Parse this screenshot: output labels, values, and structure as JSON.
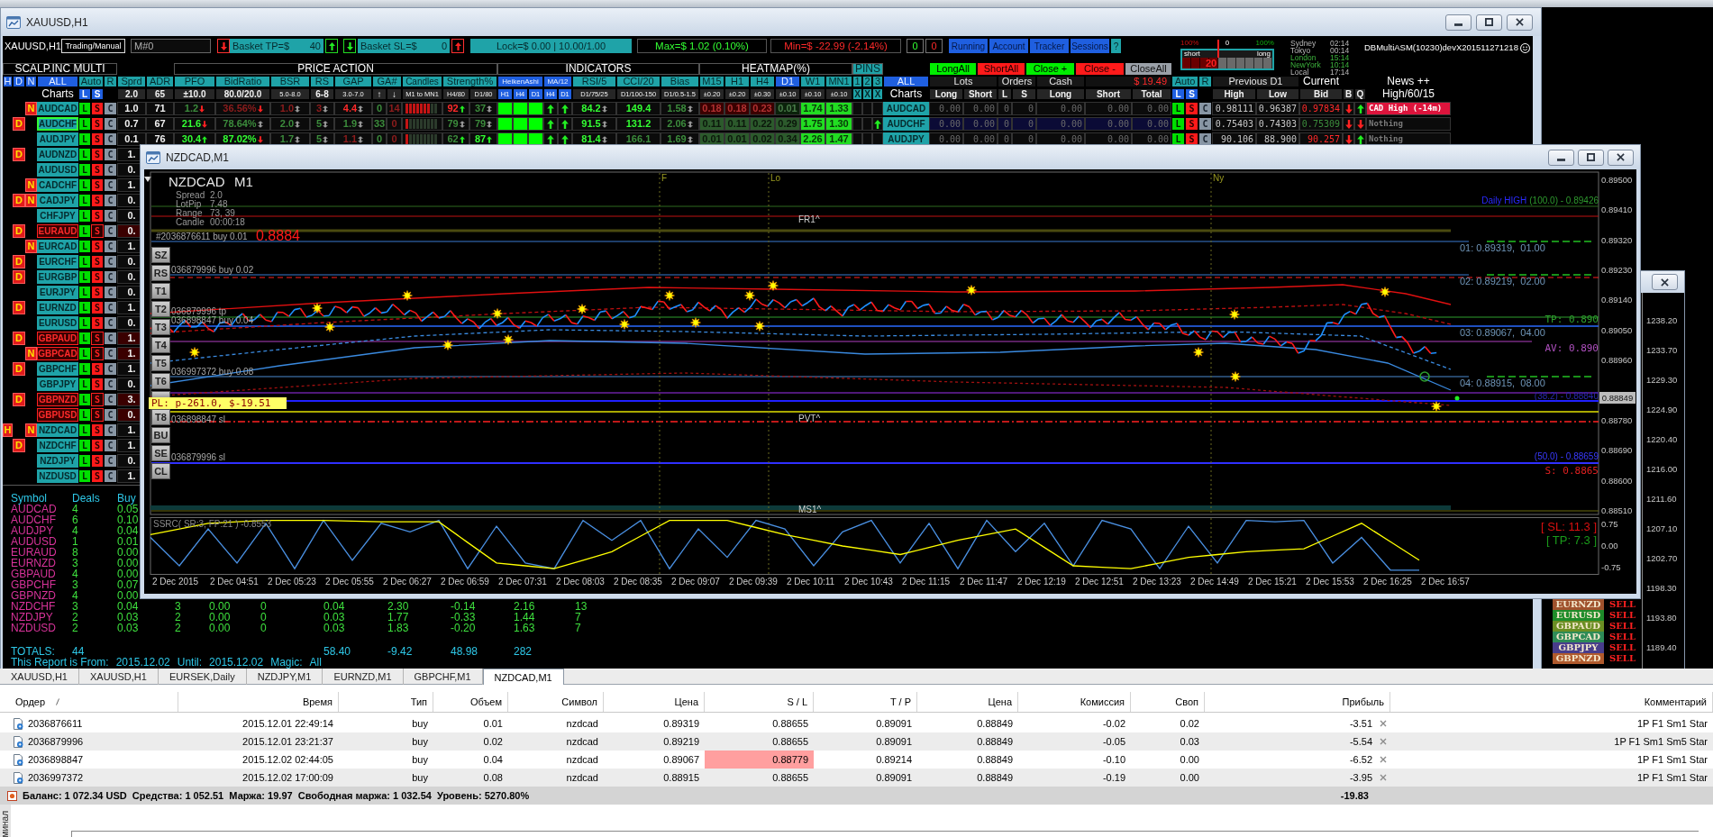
{
  "main_window": {
    "title": "XAUUSD,H1"
  },
  "dashboard": {
    "toolbar": {
      "chart_label": "XAUUSD,H1",
      "mode": "Trading/Manual",
      "magic": {
        "value": "M#0"
      },
      "basket_tp": {
        "label": "Basket TP=$",
        "value": "40"
      },
      "basket_sl": {
        "label": "Basket SL=$",
        "value": "0"
      },
      "lock": "Lock=$ 0.00 | 10.00/1.00",
      "max": "Max=$ 1.02 (0.10%)",
      "min": "Min=$ -22.99 (-2.14%)",
      "counters": [
        {
          "value": "0",
          "kind": "buy"
        },
        {
          "value": "0",
          "kind": "sell"
        }
      ],
      "panel_buttons": [
        {
          "label": "Running",
          "kind": "panel"
        },
        {
          "label": "Account",
          "kind": "panel"
        },
        {
          "label": "Tracker",
          "kind": "panel"
        },
        {
          "label": "Sessions",
          "kind": "panel"
        },
        {
          "label": "?",
          "kind": "help"
        }
      ]
    },
    "trade_buttons": [
      {
        "label": "LongAll",
        "kind": "long"
      },
      {
        "label": "ShortAll",
        "kind": "short"
      },
      {
        "label": "Close +",
        "kind": "long"
      },
      {
        "label": "Close -",
        "kind": "short"
      },
      {
        "label": "CloseAll",
        "kind": "neutral"
      }
    ],
    "gauge": {
      "short_max": "100%",
      "center": "0",
      "long_max": "100%",
      "short_label": "short",
      "long_label": "long",
      "value": "20",
      "level": 0.4
    },
    "sessions": [
      {
        "city": "Sydney",
        "time": "02:14",
        "open": false
      },
      {
        "city": "Tokyo",
        "time": "00:14",
        "open": false
      },
      {
        "city": "London",
        "time": "15:14",
        "open": true
      },
      {
        "city": "NewYork",
        "time": "10:14",
        "open": true
      },
      {
        "city": "Local",
        "time": "17:14",
        "open": false
      }
    ],
    "version": "DBMultiASM(10230)devX201511271218",
    "sections": [
      "SCALP.INC MULTI",
      "PRICE ACTION",
      "INDICATORS",
      "HEATMAP(%)",
      "PINS"
    ],
    "header": [
      "H",
      "D",
      "N",
      "ALL",
      "Auto",
      "R",
      "Sprd",
      "ADR",
      "PFO",
      "BidRatio",
      "BSR",
      "RS",
      "GAP",
      "GA#",
      "Candles",
      "Strength%",
      "HeikenAshi",
      "MA/12",
      "RSI/5",
      "CCI/20",
      "Bias",
      "M15",
      "H1",
      "H4",
      "D1",
      "W1",
      "MN1",
      "1",
      "2",
      "3",
      "ALL",
      "Lots",
      "Orders",
      "Cash",
      "$ 19.49",
      "Auto",
      "R",
      "Previous D1",
      "Current",
      "News ++"
    ],
    "subheader": [
      "Charts",
      "L",
      "S",
      "2.0",
      "65",
      "±10.0",
      "80.0/20.0",
      "5.0-8.0",
      "6-8",
      "3.0-7.0",
      "↑",
      "↓",
      "M1 to MN1",
      "H4/80",
      "D1/80",
      "H1",
      "H4",
      "D1",
      "H4",
      "D1",
      "D1/75/25",
      "D1/100-150",
      "D1/0.5-1.5",
      "±0.20",
      "±0.20",
      "±0.30",
      "±0.10",
      "±0.10",
      "±0.10",
      "X",
      "X",
      "X",
      "Charts",
      "Long",
      "Short",
      "L",
      "S",
      "Long",
      "Short",
      "Total",
      "L",
      "S",
      "High",
      "Low",
      "Bid",
      "B",
      "Q",
      "High/60/15"
    ],
    "rows": [
      {
        "flags": [
          {
            "kind": "n",
            "label": "N"
          }
        ],
        "symbol": "AUDCAD",
        "alert": false,
        "active": false,
        "buttons": [
          "L",
          "S",
          "C"
        ],
        "cells": [
          {
            "kind": "value",
            "text": "1.0"
          },
          {
            "kind": "value",
            "text": "71"
          },
          {
            "kind": "value",
            "text": "1.2",
            "color": "#3c8c3c",
            "down": true
          },
          {
            "kind": "value",
            "text": "36.56%",
            "color": "#8f1d1d",
            "down": true
          },
          {
            "kind": "value",
            "text": "1.0",
            "color": "#8f1d1d",
            "up": true,
            "down": true
          },
          {
            "kind": "value",
            "text": "3",
            "color": "#8f1d1d",
            "up": true,
            "down": true
          },
          {
            "kind": "value",
            "text": "4.4",
            "color": "#ff2a2a",
            "up": true,
            "down": true
          },
          {
            "kind": "value",
            "text": "0",
            "color": "#3c8c3c"
          },
          {
            "kind": "value",
            "text": "14",
            "color": "#8f1d1d"
          },
          {
            "kind": "bars",
            "bars": [
              {
                "color": "#c41414"
              },
              {
                "color": "#c41414"
              },
              {
                "color": "#c41414"
              },
              {
                "color": "#c41414"
              },
              {
                "color": "#c41414"
              },
              {
                "color": "#c41414"
              },
              {
                "color": "#c41414"
              },
              {
                "color": "#2b3a2b"
              },
              {
                "color": "#2b3a2b"
              }
            ]
          },
          {
            "kind": "value",
            "text": "92",
            "color": "#ff2a2a",
            "up": true
          },
          {
            "kind": "value",
            "text": "37",
            "color": "#3c8c3c",
            "up": true,
            "down": true
          },
          {
            "kind": "signal",
            "color": "#00ff00"
          },
          {
            "kind": "signal",
            "color": "#00ff00"
          },
          {
            "kind": "signal",
            "color": "#00ff00"
          },
          {
            "kind": "arrow",
            "up": true
          },
          {
            "kind": "arrow",
            "up": true
          },
          {
            "kind": "value",
            "text": "84.2",
            "color": "#33ff33",
            "up": true,
            "down": true
          },
          {
            "kind": "value",
            "text": "149.4",
            "color": "#33ff33"
          },
          {
            "kind": "value",
            "text": "1.58",
            "color": "#3c8c3c",
            "up": true,
            "down": true
          },
          {
            "kind": "heat",
            "text": "0.18",
            "color": "#3a0000"
          },
          {
            "kind": "heat",
            "text": "0.18",
            "color": "#3a0000"
          },
          {
            "kind": "heat",
            "text": "0.23",
            "color": "#3a0000"
          },
          {
            "kind": "heat",
            "text": "0.01",
            "color": "#0b220b"
          },
          {
            "kind": "heat",
            "text": "1.74",
            "color": "#22dd22"
          },
          {
            "kind": "heat",
            "text": "1.33",
            "color": "#22dd22"
          },
          {
            "kind": "blank"
          },
          {
            "kind": "blank"
          },
          {
            "kind": "blank"
          },
          {
            "kind": "symbol",
            "text": "AUDCAD"
          },
          {
            "kind": "value",
            "text": "0.00",
            "dim": true
          },
          {
            "kind": "value",
            "text": "0.00",
            "dim": true
          },
          {
            "kind": "value",
            "text": "0",
            "dim": true
          },
          {
            "kind": "value",
            "text": "0",
            "dim": true
          },
          {
            "kind": "value",
            "text": "0.00",
            "dim": true
          },
          {
            "kind": "value",
            "text": "0.00",
            "dim": true
          },
          {
            "kind": "value",
            "text": "0.00",
            "dim": true
          },
          {
            "kind": "long",
            "text": "L"
          },
          {
            "kind": "short",
            "text": "S"
          },
          {
            "kind": "close",
            "text": "C"
          },
          {
            "kind": "value",
            "text": "0.98111"
          },
          {
            "kind": "value",
            "text": "0.96387"
          },
          {
            "kind": "value",
            "text": "0.97834",
            "color": "#ff2a2a"
          },
          {
            "kind": "arrow",
            "down": true
          },
          {
            "kind": "arrow",
            "up": true
          },
          {
            "kind": "news",
            "text": "CAD High (-14m)",
            "color": "#dc143c",
            "dim": false
          }
        ]
      },
      {
        "flags": [
          {
            "kind": "d",
            "label": "D"
          }
        ],
        "symbol": "AUDCHF",
        "alert": false,
        "active": true,
        "buttons": [
          "L",
          "S",
          "C"
        ],
        "cells": [
          {
            "kind": "value",
            "text": "0.7"
          },
          {
            "kind": "value",
            "text": "67"
          },
          {
            "kind": "value",
            "text": "21.6",
            "color": "#33ff33",
            "down": true
          },
          {
            "kind": "value",
            "text": "78.64%",
            "color": "#3c8c3c",
            "up": true,
            "down": true
          },
          {
            "kind": "value",
            "text": "2.0",
            "color": "#3c8c3c",
            "up": true,
            "down": true
          },
          {
            "kind": "value",
            "text": "5",
            "color": "#3c8c3c",
            "up": true,
            "down": true
          },
          {
            "kind": "value",
            "text": "1.9",
            "color": "#3c8c3c",
            "up": true,
            "down": true
          },
          {
            "kind": "value",
            "text": "33",
            "color": "#3c8c3c"
          },
          {
            "kind": "value",
            "text": "0",
            "color": "#8f1d1d"
          },
          {
            "kind": "bars",
            "bars": [
              {
                "color": "#c41414"
              },
              {
                "color": "#2b3a2b"
              },
              {
                "color": "#2b3a2b"
              },
              {
                "color": "#2b3a2b"
              },
              {
                "color": "#2b3a2b"
              },
              {
                "color": "#2b3a2b"
              },
              {
                "color": "#2b3a2b"
              },
              {
                "color": "#2b3a2b"
              },
              {
                "color": "#2b3a2b"
              }
            ]
          },
          {
            "kind": "value",
            "text": "79",
            "color": "#3c8c3c",
            "up": true,
            "down": true
          },
          {
            "kind": "value",
            "text": "79",
            "color": "#3c8c3c",
            "up": true,
            "down": true
          },
          {
            "kind": "signal",
            "color": "#00ff00"
          },
          {
            "kind": "signal",
            "color": "#00ff00"
          },
          {
            "kind": "signal",
            "color": "#00ff00"
          },
          {
            "kind": "arrow",
            "up": true
          },
          {
            "kind": "arrow",
            "up": true
          },
          {
            "kind": "value",
            "text": "91.5",
            "color": "#33ff33",
            "up": true,
            "down": true
          },
          {
            "kind": "value",
            "text": "131.2",
            "color": "#33ff33"
          },
          {
            "kind": "value",
            "text": "2.06",
            "color": "#3c8c3c",
            "up": true,
            "down": true
          },
          {
            "kind": "heat",
            "text": "0.11",
            "color": "#2c5a2c"
          },
          {
            "kind": "heat",
            "text": "0.11",
            "color": "#2c5a2c"
          },
          {
            "kind": "heat",
            "text": "0.22",
            "color": "#2c5a2c"
          },
          {
            "kind": "heat",
            "text": "0.29",
            "color": "#2c5a2c"
          },
          {
            "kind": "heat",
            "text": "1.75",
            "color": "#22dd22"
          },
          {
            "kind": "heat",
            "text": "1.30",
            "color": "#22dd22"
          },
          {
            "kind": "blank"
          },
          {
            "kind": "blank"
          },
          {
            "kind": "arrow",
            "up": true
          },
          {
            "kind": "symbol",
            "text": "AUDCHF"
          },
          {
            "kind": "value",
            "text": "0.00",
            "dim": true
          },
          {
            "kind": "value",
            "text": "0.00",
            "dim": true
          },
          {
            "kind": "value",
            "text": "0",
            "dim": true
          },
          {
            "kind": "value",
            "text": "0",
            "dim": true
          },
          {
            "kind": "value",
            "text": "0.00",
            "dim": true
          },
          {
            "kind": "value",
            "text": "0.00",
            "dim": true
          },
          {
            "kind": "value",
            "text": "0.00",
            "dim": true
          },
          {
            "kind": "long",
            "text": "L"
          },
          {
            "kind": "short",
            "text": "S"
          },
          {
            "kind": "close",
            "text": "C"
          },
          {
            "kind": "value",
            "text": "0.75403"
          },
          {
            "kind": "value",
            "text": "0.74303"
          },
          {
            "kind": "value",
            "text": "0.75309",
            "color": "#3c8c3c"
          },
          {
            "kind": "arrow",
            "down": true
          },
          {
            "kind": "arrow",
            "down": true
          },
          {
            "kind": "news",
            "text": "Nothing",
            "dim": true
          }
        ]
      },
      {
        "flags": [],
        "symbol": "AUDJPY",
        "alert": false,
        "active": false,
        "buttons": [
          "L",
          "S",
          "C"
        ],
        "cells": [
          {
            "kind": "value",
            "text": "0.1"
          },
          {
            "kind": "value",
            "text": "76"
          },
          {
            "kind": "value",
            "text": "30.4",
            "color": "#33ff33",
            "up": true
          },
          {
            "kind": "value",
            "text": "87.02%",
            "color": "#33ff33",
            "down": true
          },
          {
            "kind": "value",
            "text": "1.7",
            "color": "#3c8c3c",
            "up": true,
            "down": true
          },
          {
            "kind": "value",
            "text": "5",
            "color": "#3c8c3c",
            "up": true,
            "down": true
          },
          {
            "kind": "value",
            "text": "1.1",
            "color": "#8f1d1d",
            "up": true,
            "down": true
          },
          {
            "kind": "value",
            "text": "0",
            "color": "#3c8c3c"
          },
          {
            "kind": "value",
            "text": "0",
            "color": "#8f1d1d"
          },
          {
            "kind": "bars",
            "bars": [
              {
                "color": "#c41414"
              },
              {
                "color": "#2b3a2b"
              },
              {
                "color": "#2b3a2b"
              },
              {
                "color": "#2b3a2b"
              },
              {
                "color": "#2b3a2b"
              },
              {
                "color": "#2b3a2b"
              },
              {
                "color": "#2b3a2b"
              },
              {
                "color": "#2b3a2b"
              },
              {
                "color": "#2b3a2b"
              }
            ]
          },
          {
            "kind": "value",
            "text": "62",
            "color": "#3c8c3c",
            "up": true
          },
          {
            "kind": "value",
            "text": "87",
            "color": "#33ff33",
            "up": true
          },
          {
            "kind": "signal",
            "color": "#00ff00"
          },
          {
            "kind": "signal",
            "color": "#00ff00"
          },
          {
            "kind": "signal",
            "color": "#00ff00"
          },
          {
            "kind": "arrow",
            "up": true
          },
          {
            "kind": "arrow",
            "up": true
          },
          {
            "kind": "value",
            "text": "81.4",
            "color": "#33ff33",
            "up": true,
            "down": true
          },
          {
            "kind": "value",
            "text": "166.1",
            "color": "#3c8c3c"
          },
          {
            "kind": "value",
            "text": "1.69",
            "color": "#3c8c3c",
            "up": true,
            "down": true
          },
          {
            "kind": "heat",
            "text": "0.01",
            "color": "#2c5a2c"
          },
          {
            "kind": "heat",
            "text": "0.01",
            "color": "#2c5a2c"
          },
          {
            "kind": "heat",
            "text": "0.02",
            "color": "#2c5a2c"
          },
          {
            "kind": "heat",
            "text": "0.34",
            "color": "#2c5a2c"
          },
          {
            "kind": "heat",
            "text": "2.26",
            "color": "#22dd22"
          },
          {
            "kind": "heat",
            "text": "1.47",
            "color": "#22dd22"
          },
          {
            "kind": "blank"
          },
          {
            "kind": "blank"
          },
          {
            "kind": "blank"
          },
          {
            "kind": "symbol",
            "text": "AUDJPY"
          },
          {
            "kind": "value",
            "text": "0.00",
            "dim": true
          },
          {
            "kind": "value",
            "text": "0.00",
            "dim": true
          },
          {
            "kind": "value",
            "text": "0",
            "dim": true
          },
          {
            "kind": "value",
            "text": "0",
            "dim": true
          },
          {
            "kind": "value",
            "text": "0.00",
            "dim": true
          },
          {
            "kind": "value",
            "text": "0.00",
            "dim": true
          },
          {
            "kind": "value",
            "text": "0.00",
            "dim": true
          },
          {
            "kind": "long",
            "text": "L"
          },
          {
            "kind": "short",
            "text": "S"
          },
          {
            "kind": "close",
            "text": "C"
          },
          {
            "kind": "value",
            "text": "90.106"
          },
          {
            "kind": "value",
            "text": "88.900"
          },
          {
            "kind": "value",
            "text": "90.257",
            "color": "#ff2a2a"
          },
          {
            "kind": "arrow",
            "down": true
          },
          {
            "kind": "arrow",
            "up": true
          },
          {
            "kind": "news",
            "text": "Nothing",
            "dim": true
          }
        ]
      },
      {
        "flags": [
          {
            "kind": "d",
            "label": "D"
          }
        ],
        "symbol": "AUDNZD",
        "alert": false,
        "active": false,
        "buttons": [
          "L",
          "S",
          "C"
        ],
        "cells": [
          {
            "kind": "value",
            "text": "1."
          }
        ]
      },
      {
        "flags": [],
        "symbol": "AUDUSD",
        "alert": false,
        "active": false,
        "buttons": [
          "L",
          "S",
          "C"
        ],
        "cells": [
          {
            "kind": "value",
            "text": "0."
          }
        ]
      },
      {
        "flags": [
          {
            "kind": "n",
            "label": "N"
          }
        ],
        "symbol": "CADCHF",
        "alert": false,
        "active": false,
        "buttons": [
          "L",
          "S",
          "C"
        ],
        "cells": [
          {
            "kind": "value",
            "text": "1."
          }
        ]
      },
      {
        "flags": [
          {
            "kind": "d",
            "label": "D"
          },
          {
            "kind": "n",
            "label": "N"
          }
        ],
        "symbol": "CADJPY",
        "alert": false,
        "active": false,
        "buttons": [
          "L",
          "S",
          "C"
        ],
        "cells": [
          {
            "kind": "value",
            "text": "0."
          }
        ]
      },
      {
        "flags": [],
        "symbol": "CHFJPY",
        "alert": false,
        "active": false,
        "buttons": [
          "L",
          "S",
          "C"
        ],
        "cells": [
          {
            "kind": "value",
            "text": "0."
          }
        ]
      },
      {
        "flags": [
          {
            "kind": "d",
            "label": "D"
          }
        ],
        "symbol": "EURAUD",
        "alert": true,
        "active": false,
        "buttons": [
          "L",
          "S",
          "C"
        ],
        "cells": [
          {
            "kind": "value",
            "text": "0."
          }
        ]
      },
      {
        "flags": [
          {
            "kind": "n",
            "label": "N"
          }
        ],
        "symbol": "EURCAD",
        "alert": false,
        "active": false,
        "buttons": [
          "L",
          "S",
          "C"
        ],
        "cells": [
          {
            "kind": "value",
            "text": "1."
          }
        ]
      },
      {
        "flags": [
          {
            "kind": "d",
            "label": "D"
          }
        ],
        "symbol": "EURCHF",
        "alert": false,
        "active": false,
        "buttons": [
          "L",
          "S",
          "C"
        ],
        "cells": [
          {
            "kind": "value",
            "text": "0."
          }
        ]
      },
      {
        "flags": [
          {
            "kind": "d",
            "label": "D"
          }
        ],
        "symbol": "EURGBP",
        "alert": false,
        "active": false,
        "buttons": [
          "L",
          "S",
          "C"
        ],
        "cells": [
          {
            "kind": "value",
            "text": "0."
          }
        ]
      },
      {
        "flags": [],
        "symbol": "EURJPY",
        "alert": false,
        "active": false,
        "buttons": [
          "L",
          "S",
          "C"
        ],
        "cells": [
          {
            "kind": "value",
            "text": "0."
          }
        ]
      },
      {
        "flags": [
          {
            "kind": "d",
            "label": "D"
          }
        ],
        "symbol": "EURNZD",
        "alert": false,
        "active": false,
        "buttons": [
          "L",
          "S",
          "C"
        ],
        "cells": [
          {
            "kind": "value",
            "text": "1."
          }
        ]
      },
      {
        "flags": [],
        "symbol": "EURUSD",
        "alert": false,
        "active": false,
        "buttons": [
          "L",
          "S",
          "C"
        ],
        "cells": [
          {
            "kind": "value",
            "text": "0."
          }
        ]
      },
      {
        "flags": [
          {
            "kind": "d",
            "label": "D"
          }
        ],
        "symbol": "GBPAUD",
        "alert": true,
        "active": false,
        "buttons": [
          "L",
          "S",
          "C"
        ],
        "cells": [
          {
            "kind": "value",
            "text": "1."
          }
        ]
      },
      {
        "flags": [
          {
            "kind": "n",
            "label": "N"
          }
        ],
        "symbol": "GBPCAD",
        "alert": true,
        "active": false,
        "buttons": [
          "L",
          "S",
          "C"
        ],
        "cells": [
          {
            "kind": "value",
            "text": "1."
          }
        ]
      },
      {
        "flags": [
          {
            "kind": "d",
            "label": "D"
          }
        ],
        "symbol": "GBPCHF",
        "alert": false,
        "active": false,
        "buttons": [
          "L",
          "S",
          "C"
        ],
        "cells": [
          {
            "kind": "value",
            "text": "1."
          }
        ]
      },
      {
        "flags": [],
        "symbol": "GBPJPY",
        "alert": false,
        "active": false,
        "buttons": [
          "L",
          "S",
          "C"
        ],
        "cells": [
          {
            "kind": "value",
            "text": "0."
          }
        ]
      },
      {
        "flags": [
          {
            "kind": "d",
            "label": "D"
          }
        ],
        "symbol": "GBPNZD",
        "alert": true,
        "active": false,
        "buttons": [
          "L",
          "S",
          "C"
        ],
        "cells": [
          {
            "kind": "value",
            "text": "3."
          }
        ]
      },
      {
        "flags": [],
        "symbol": "GBPUSD",
        "alert": true,
        "active": false,
        "buttons": [
          "L",
          "S",
          "C"
        ],
        "cells": [
          {
            "kind": "value",
            "text": "0."
          }
        ]
      },
      {
        "flags": [
          {
            "kind": "h",
            "label": "H"
          },
          {
            "kind": "n",
            "label": "N"
          }
        ],
        "symbol": "NZDCAD",
        "alert": false,
        "active": false,
        "buttons": [
          "L",
          "S",
          "C"
        ],
        "cells": [
          {
            "kind": "value",
            "text": "1."
          }
        ]
      },
      {
        "flags": [
          {
            "kind": "d",
            "label": "D"
          }
        ],
        "symbol": "NZDCHF",
        "alert": false,
        "active": false,
        "buttons": [
          "L",
          "S",
          "C"
        ],
        "cells": [
          {
            "kind": "value",
            "text": "1."
          }
        ]
      },
      {
        "flags": [],
        "symbol": "NZDJPY",
        "alert": false,
        "active": false,
        "buttons": [
          "L",
          "S",
          "C"
        ],
        "cells": [
          {
            "kind": "value",
            "text": "0."
          }
        ]
      },
      {
        "flags": [],
        "symbol": "NZDUSD",
        "alert": false,
        "active": false,
        "buttons": [
          "L",
          "S",
          "C"
        ],
        "cells": [
          {
            "kind": "value",
            "text": "1."
          }
        ]
      }
    ]
  },
  "report": {
    "columns": [
      "Symbol",
      "Deals",
      "Buy"
    ],
    "rows": [
      {
        "symbol": "AUDCAD",
        "values": [
          "4",
          "0.05"
        ]
      },
      {
        "symbol": "AUDCHF",
        "values": [
          "6",
          "0.10"
        ]
      },
      {
        "symbol": "AUDJPY",
        "values": [
          "4",
          "0.04"
        ]
      },
      {
        "symbol": "AUDUSD",
        "values": [
          "1",
          "0.01"
        ]
      },
      {
        "symbol": "EURAUD",
        "values": [
          "8",
          "0.00"
        ]
      },
      {
        "symbol": "EURNZD",
        "values": [
          "3",
          "0.00"
        ]
      },
      {
        "symbol": "GBPAUD",
        "values": [
          "4",
          "0.00"
        ]
      },
      {
        "symbol": "GBPCHF",
        "values": [
          "3",
          "0.07"
        ]
      },
      {
        "symbol": "GBPNZD",
        "values": [
          "4",
          "0.00"
        ]
      },
      {
        "symbol": "NZDCHF",
        "values": [
          "3",
          "0.04",
          "3",
          "0.00",
          "0",
          "0.04",
          "2.30",
          "-0.14",
          "2.16",
          "13"
        ]
      },
      {
        "symbol": "NZDJPY",
        "values": [
          "2",
          "0.03",
          "2",
          "0.00",
          "0",
          "0.03",
          "1.77",
          "-0.33",
          "1.44",
          "7"
        ]
      },
      {
        "symbol": "NZDUSD",
        "values": [
          "2",
          "0.03",
          "2",
          "0.00",
          "0",
          "0.03",
          "1.83",
          "-0.20",
          "1.63",
          "7"
        ]
      }
    ],
    "totals": {
      "label": "TOTALS:",
      "values": [
        "44",
        "58.40",
        "-9.42",
        "48.98",
        "282"
      ]
    },
    "period": [
      "This Report is From:",
      "2015.12.02",
      "Until:",
      "2015.12.02",
      "Magic:",
      "All"
    ]
  },
  "chart_window": {
    "title": "NZDCAD,M1",
    "symbol": "NZDCAD",
    "timeframe": "M1",
    "info": [
      {
        "label": "Spread",
        "value": "2.0"
      },
      {
        "label": "LotPip",
        "value": "7.48"
      },
      {
        "label": "Range",
        "value": "73, 39"
      },
      {
        "label": "Candle",
        "value": "00:00:18"
      }
    ],
    "order_label": "#2036876611 buy 0.01",
    "bid": "0.8884",
    "side_buttons": [
      "SZ",
      "RS",
      "T1",
      "T2",
      "T3",
      "T4",
      "T5",
      "T6",
      "T8",
      "BU",
      "SE",
      "CL"
    ],
    "trade_labels": [
      "036879996 buy 0.02",
      "036879996 tp",
      "036898847 buy 0.04",
      "036997372 buy 0.08",
      "036898847 sl",
      "036879996 sl"
    ],
    "pl_label": "PL: p-261.0, $-19.51",
    "session_marks": [
      "F",
      "Lo",
      "Ny"
    ],
    "pivots": [
      "FR1^",
      "PVT^",
      "MS1^"
    ],
    "daily_high": {
      "label": "Daily HIGH",
      "value": "(100.0) - 0.89426"
    },
    "order_levels": [
      "01: 0.89319,  01.00",
      "02: 0.89219,  02.00",
      "03: 0.89067,  04.00",
      "04: 0.88915,  08.00"
    ],
    "tp_label": "TP: 0.890",
    "average_label": "AV: 0.890",
    "fib_labels": [
      "(38.2) - 0.88840",
      "(50.0) - 0.88659"
    ],
    "support_label": "S: 0.8865",
    "current_price": "0.88849",
    "price_ticks": [
      "0.89500",
      "0.89410",
      "0.89320",
      "0.89230",
      "0.89140",
      "0.89050",
      "0.88960",
      "0.88780",
      "0.88690",
      "0.88600",
      "0.88510"
    ],
    "time_labels": [
      "2 Dec 2015",
      "2 Dec 04:51",
      "2 Dec 05:23",
      "2 Dec 05:55",
      "2 Dec 06:27",
      "2 Dec 06:59",
      "2 Dec 07:31",
      "2 Dec 08:03",
      "2 Dec 08:35",
      "2 Dec 09:07",
      "2 Dec 09:39",
      "2 Dec 10:11",
      "2 Dec 10:43",
      "2 Dec 11:15",
      "2 Dec 11:47",
      "2 Dec 12:19",
      "2 Dec 12:51",
      "2 Dec 13:23",
      "2 Dec 14:49",
      "2 Dec 15:21",
      "2 Dec 15:53",
      "2 Dec 16:25",
      "2 Dec 16:57"
    ],
    "oscillator": {
      "title": "SSRC( SR:3, FP:21 ) -0.8553",
      "stop_loss": "[ SL: 11.3 ]",
      "take_profit": "[ TP: 7.3 ]",
      "ticks": [
        "0.75",
        "0.00",
        "-0.75"
      ]
    }
  },
  "side_window": {
    "price_axis": [
      "1238.20",
      "1233.70",
      "1229.30",
      "1224.90",
      "1220.40",
      "1216.00",
      "1211.60",
      "1207.10",
      "1202.70",
      "1198.30",
      "1193.80",
      "1189.40"
    ],
    "signals": [
      {
        "symbol": "EURNZD",
        "action": "SELL",
        "color": "#a0522d"
      },
      {
        "symbol": "EURUSD",
        "action": "SELL",
        "color": "#1e8c2a"
      },
      {
        "symbol": "GBPAUD",
        "action": "SELL",
        "color": "#6b8e23"
      },
      {
        "symbol": "GBPCAD",
        "action": "SELL",
        "color": "#2e8b57"
      },
      {
        "symbol": "GBPJPY",
        "action": "SELL",
        "color": "#483d8b"
      },
      {
        "symbol": "GBPNZD",
        "action": "SELL",
        "color": "#b05a2d"
      }
    ]
  },
  "terminal": {
    "tabs": [
      {
        "label": "XAUUSD,H1",
        "selected": false
      },
      {
        "label": "XAUUSD,H1",
        "selected": false
      },
      {
        "label": "EURSEK,Daily",
        "selected": false
      },
      {
        "label": "NZDJPY,M1",
        "selected": false
      },
      {
        "label": "EURNZD,M1",
        "selected": false
      },
      {
        "label": "GBPCHF,M1",
        "selected": false
      },
      {
        "label": "NZDCAD,M1",
        "selected": true
      }
    ],
    "columns": [
      "Ордер",
      "Время",
      "Тип",
      "Объем",
      "Символ",
      "Цена",
      "S / L",
      "T / P",
      "Цена",
      "Комиссия",
      "Своп",
      "Прибыль",
      "Комментарий"
    ],
    "rows": [
      {
        "order": "2036876611",
        "time": "2015.12.01 22:49:14",
        "type": "buy",
        "volume": "0.01",
        "symbol": "nzdcad",
        "open_price": "0.89319",
        "sl": "0.88655",
        "tp": "0.89091",
        "price": "0.88849",
        "commission": "-0.02",
        "swap": "0.02",
        "profit": "-3.51",
        "comment": "1P F1 Sm1 Star",
        "sl_highlighted": false
      },
      {
        "order": "2036879996",
        "time": "2015.12.01 23:21:37",
        "type": "buy",
        "volume": "0.02",
        "symbol": "nzdcad",
        "open_price": "0.89219",
        "sl": "0.88655",
        "tp": "0.89091",
        "price": "0.88849",
        "commission": "-0.05",
        "swap": "0.03",
        "profit": "-5.54",
        "comment": "1P F1 Sm1 Sm5 Star",
        "sl_highlighted": false
      },
      {
        "order": "2036898847",
        "time": "2015.12.02 02:44:05",
        "type": "buy",
        "volume": "0.04",
        "symbol": "nzdcad",
        "open_price": "0.89067",
        "sl": "0.88779",
        "tp": "0.89214",
        "price": "0.88849",
        "commission": "-0.10",
        "swap": "0.00",
        "profit": "-6.52",
        "comment": "1P F1 Sm1 Star",
        "sl_highlighted": true
      },
      {
        "order": "2036997372",
        "time": "2015.12.02 17:00:09",
        "type": "buy",
        "volume": "0.08",
        "symbol": "nzdcad",
        "open_price": "0.88915",
        "sl": "0.88655",
        "tp": "0.89091",
        "price": "0.88849",
        "commission": "-0.19",
        "swap": "0.00",
        "profit": "-3.95",
        "comment": "1P F1 Sm1 Star",
        "sl_highlighted": false
      }
    ],
    "summary": {
      "text": "Баланс: 1 072.34 USD  Средства: 1 052.51  Маржа: 19.97  Свободная маржа: 1 032.54  Уровень: 5270.80%",
      "profit": "-19.83"
    },
    "side_label": "минал"
  }
}
